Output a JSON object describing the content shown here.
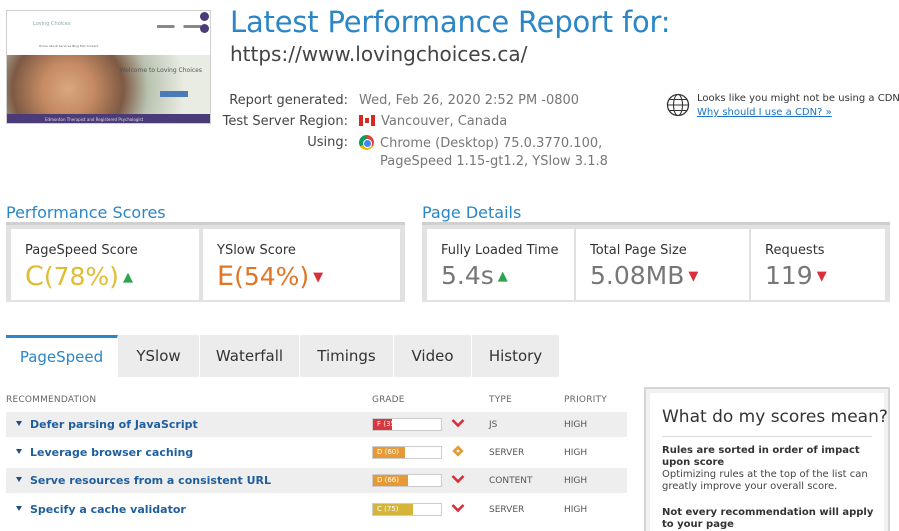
{
  "thumbnail": {
    "logo": "Loving Choices",
    "menu": "Home  About  Services  Blog  FAQ  Contact",
    "hero_text": "Welcome to Loving Choices",
    "footer_text": "Edmonton Therapist and Registered Psychologist"
  },
  "header": {
    "title": "Latest Performance Report for:",
    "url": "https://www.lovingchoices.ca/"
  },
  "meta": {
    "generated_label": "Report generated:",
    "generated_value": "Wed, Feb 26, 2020 2:52 PM -0800",
    "region_label": "Test Server Region:",
    "region_value": "Vancouver, Canada",
    "using_label": "Using:",
    "using_value_1": "Chrome (Desktop) 75.0.3770.100,",
    "using_value_2": "PageSpeed 1.15-gt1.2, YSlow 3.1.8"
  },
  "cdn": {
    "text": "Looks like you might not be using a CDN",
    "link": "Why should I use a CDN? »"
  },
  "performance": {
    "title": "Performance Scores",
    "pagespeed_label": "PageSpeed Score",
    "pagespeed_grade": "C",
    "pagespeed_pct": "(78%)",
    "yslow_label": "YSlow Score",
    "yslow_grade": "E",
    "yslow_pct": "(54%)"
  },
  "details": {
    "title": "Page Details",
    "loaded_label": "Fully Loaded Time",
    "loaded_value": "5.4s",
    "size_label": "Total Page Size",
    "size_value": "5.08MB",
    "requests_label": "Requests",
    "requests_value": "119"
  },
  "tabs": [
    "PageSpeed",
    "YSlow",
    "Waterfall",
    "Timings",
    "Video",
    "History"
  ],
  "recommendations": {
    "headers": {
      "recommendation": "RECOMMENDATION",
      "grade": "GRADE",
      "type": "TYPE",
      "priority": "PRIORITY"
    },
    "rows": [
      {
        "name": "Defer parsing of JavaScript",
        "grade": "F (35)",
        "score": 35,
        "color": "#d9363e",
        "status": "down",
        "type": "JS",
        "priority": "HIGH"
      },
      {
        "name": "Leverage browser caching",
        "grade": "D (60)",
        "score": 60,
        "color": "#e69a35",
        "status": "neutral",
        "type": "SERVER",
        "priority": "HIGH"
      },
      {
        "name": "Serve resources from a consistent URL",
        "grade": "D (66)",
        "score": 66,
        "color": "#e69a35",
        "status": "down",
        "type": "CONTENT",
        "priority": "HIGH"
      },
      {
        "name": "Specify a cache validator",
        "grade": "C (75)",
        "score": 75,
        "color": "#d4b53a",
        "status": "down",
        "type": "SERVER",
        "priority": "HIGH"
      }
    ]
  },
  "side": {
    "title": "What do my scores mean?",
    "bold_1": "Rules are sorted in order of impact upon score",
    "text_1": "Optimizing rules at the top of the list can greatly improve your overall score.",
    "bold_2": "Not every recommendation will apply to your page"
  },
  "colors": {
    "accent": "#2a86c6",
    "grade_c": "#e0bd2f",
    "grade_e": "#e07525",
    "up": "#2fa44f",
    "down": "#d8303a"
  }
}
